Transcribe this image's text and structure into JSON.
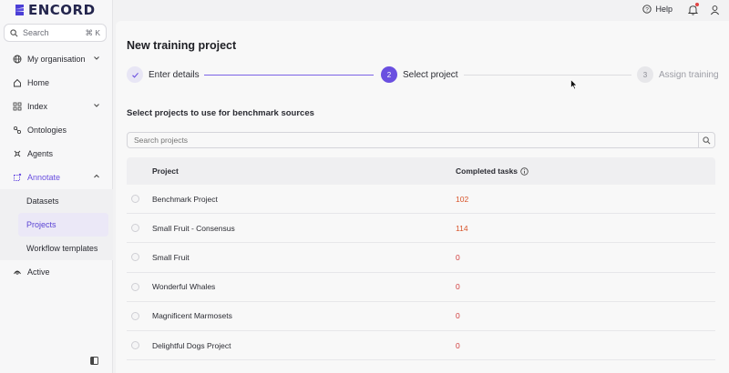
{
  "brand": {
    "name": "ENCORD"
  },
  "sidebar": {
    "search": {
      "label": "Search",
      "shortcut": "⌘ K"
    },
    "items": [
      {
        "label": "My organisation",
        "icon": "globe-icon"
      },
      {
        "label": "Home",
        "icon": "home-icon"
      },
      {
        "label": "Index",
        "icon": "grid-icon"
      },
      {
        "label": "Ontologies",
        "icon": "ontology-icon"
      },
      {
        "label": "Agents",
        "icon": "agents-icon"
      },
      {
        "label": "Annotate",
        "icon": "annotate-icon"
      },
      {
        "label": "Active",
        "icon": "active-icon"
      }
    ],
    "annotate_sub": [
      {
        "label": "Datasets"
      },
      {
        "label": "Projects"
      },
      {
        "label": "Workflow templates"
      }
    ]
  },
  "topbar": {
    "help_label": "Help"
  },
  "page": {
    "title": "New training project",
    "steps": [
      {
        "number": "",
        "label": "Enter details"
      },
      {
        "number": "2",
        "label": "Select project"
      },
      {
        "number": "3",
        "label": "Assign training"
      }
    ],
    "subheading": "Select projects to use for benchmark sources",
    "search_placeholder": "Search projects",
    "table": {
      "headers": {
        "project": "Project",
        "tasks": "Completed tasks"
      },
      "rows": [
        {
          "project": "Benchmark Project",
          "tasks": "102"
        },
        {
          "project": "Small Fruit - Consensus",
          "tasks": "114"
        },
        {
          "project": "Small Fruit",
          "tasks": "0"
        },
        {
          "project": "Wonderful Whales",
          "tasks": "0"
        },
        {
          "project": "Magnificent Marmosets",
          "tasks": "0"
        },
        {
          "project": "Delightful Dogs Project",
          "tasks": "0"
        }
      ]
    }
  },
  "colors": {
    "accent": "#6a4fe0",
    "count_positive": "#d8542a",
    "count_zero": "#d13b3b"
  }
}
